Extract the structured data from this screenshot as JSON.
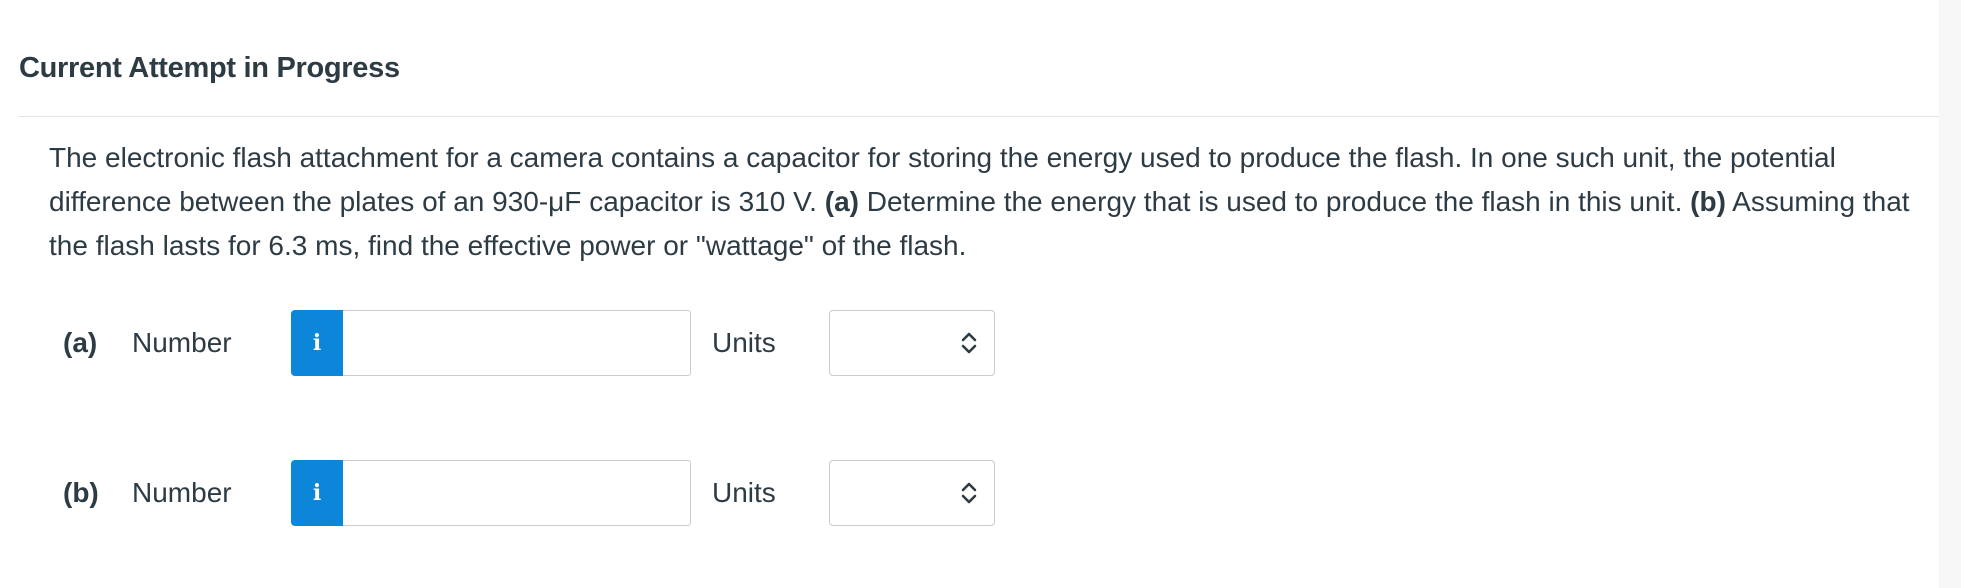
{
  "header": {
    "title": "Current Attempt in Progress"
  },
  "question": {
    "intro": "The electronic flash attachment for a camera contains a capacitor for storing the energy used to produce the flash. In one such unit, the potential difference between the plates of an 930-μF capacitor is 310 V.",
    "part_a_label": "(a)",
    "part_a_text": "Determine the energy that is used to produce the flash in this unit.",
    "part_b_label": "(b)",
    "part_b_text": "Assuming that the flash lasts for 6.3 ms, find the effective power or \"wattage\" of the flash."
  },
  "answers": [
    {
      "part": "(a)",
      "number_label": "Number",
      "info_icon": "info-icon",
      "info_glyph": "i",
      "number_value": "",
      "units_label": "Units",
      "units_value": "",
      "select_icon": "chevron-up-down-icon"
    },
    {
      "part": "(b)",
      "number_label": "Number",
      "info_icon": "info-icon",
      "info_glyph": "i",
      "number_value": "",
      "units_label": "Units",
      "units_value": "",
      "select_icon": "chevron-up-down-icon"
    }
  ],
  "colors": {
    "text": "#2d3b45",
    "info_button": "#0b86d8",
    "input_border": "#c7cdd1",
    "divider": "#e4e4e4"
  }
}
